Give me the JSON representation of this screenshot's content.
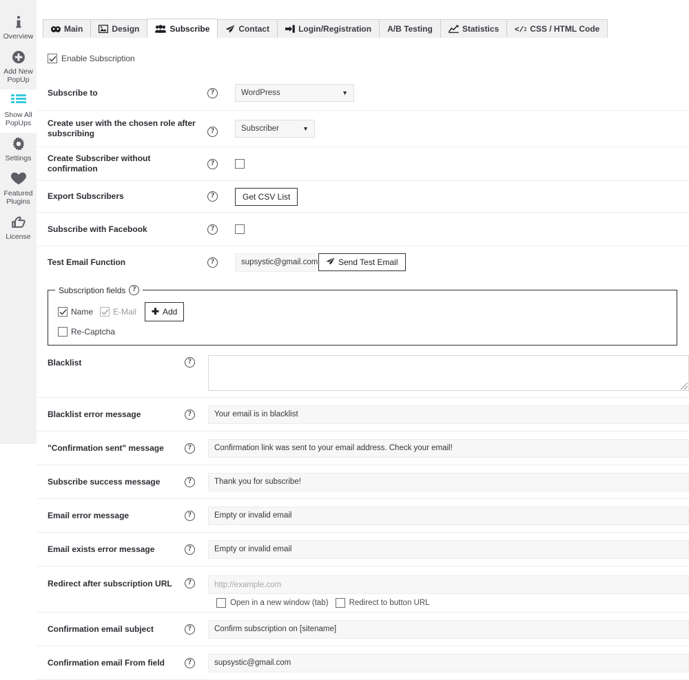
{
  "sidebar": {
    "items": [
      {
        "label": "Overview",
        "icon": "info-icon",
        "active": false
      },
      {
        "label": "Add New\nPopUp",
        "icon": "plus-circle-icon",
        "active": false
      },
      {
        "label": "Show All\nPopUps",
        "icon": "list-icon",
        "active": true
      },
      {
        "label": "Settings",
        "icon": "gear-icon",
        "active": false
      },
      {
        "label": "Featured\nPlugins",
        "icon": "heart-icon",
        "active": false
      },
      {
        "label": "License",
        "icon": "thumbs-up-icon",
        "active": false
      }
    ],
    "accent_color": "#3bc9db"
  },
  "tabs": [
    {
      "label": "Main",
      "icon": "mask-icon",
      "active": false
    },
    {
      "label": "Design",
      "icon": "image-icon",
      "active": false
    },
    {
      "label": "Subscribe",
      "icon": "users-icon",
      "active": true
    },
    {
      "label": "Contact",
      "icon": "send-icon",
      "active": false
    },
    {
      "label": "Login/Registration",
      "icon": "signin-icon",
      "active": false
    },
    {
      "label": "A/B Testing",
      "icon": "",
      "active": false
    },
    {
      "label": "Statistics",
      "icon": "chart-icon",
      "active": false
    },
    {
      "label": "CSS / HTML Code",
      "icon": "code-icon",
      "active": false
    }
  ],
  "form": {
    "enable_subscription": {
      "label": "Enable Subscription",
      "checked": true
    },
    "subscribe_to": {
      "label": "Subscribe to",
      "value": "WordPress",
      "options": [
        "WordPress"
      ]
    },
    "create_user_role": {
      "label": "Create user with the chosen role after subscribing",
      "value": "Subscriber",
      "options": [
        "Subscriber"
      ]
    },
    "create_subscriber_no_confirm": {
      "label": "Create Subscriber without confirmation",
      "checked": false
    },
    "export_subscribers": {
      "label": "Export Subscribers",
      "button_label": "Get CSV List"
    },
    "subscribe_facebook": {
      "label": "Subscribe with Facebook",
      "checked": false
    },
    "test_email": {
      "label": "Test Email Function",
      "value": "supsystic@gmail.com",
      "button_label": "Send Test Email"
    },
    "subscription_fields": {
      "legend": "Subscription fields",
      "add_label": "Add",
      "fields": [
        {
          "label": "Name",
          "checked": true,
          "disabled": false
        },
        {
          "label": "E-Mail",
          "checked": true,
          "disabled": true
        },
        {
          "label": "Re-Captcha",
          "checked": false,
          "disabled": false
        }
      ]
    },
    "blacklist": {
      "label": "Blacklist",
      "value": ""
    },
    "blacklist_error": {
      "label": "Blacklist error message",
      "value": "Your email is in blacklist"
    },
    "confirmation_sent": {
      "label": "\"Confirmation sent\" message",
      "value": "Confirmation link was sent to your email address. Check your email!"
    },
    "subscribe_success": {
      "label": "Subscribe success message",
      "value": "Thank you for subscribe!"
    },
    "email_error": {
      "label": "Email error message",
      "value": "Empty or invalid email"
    },
    "email_exists_error": {
      "label": "Email exists error message",
      "value": "Empty or invalid email"
    },
    "redirect_url": {
      "label": "Redirect after subscription URL",
      "value": "",
      "placeholder": "http://example.com",
      "open_new_window": {
        "label": "Open in a new window (tab)",
        "checked": false
      },
      "redirect_button_url": {
        "label": "Redirect to button URL",
        "checked": false
      }
    },
    "confirm_subject": {
      "label": "Confirmation email subject",
      "value": "Confirm subscription on [sitename]"
    },
    "confirm_from": {
      "label": "Confirmation email From field",
      "value": "supsystic@gmail.com"
    }
  }
}
